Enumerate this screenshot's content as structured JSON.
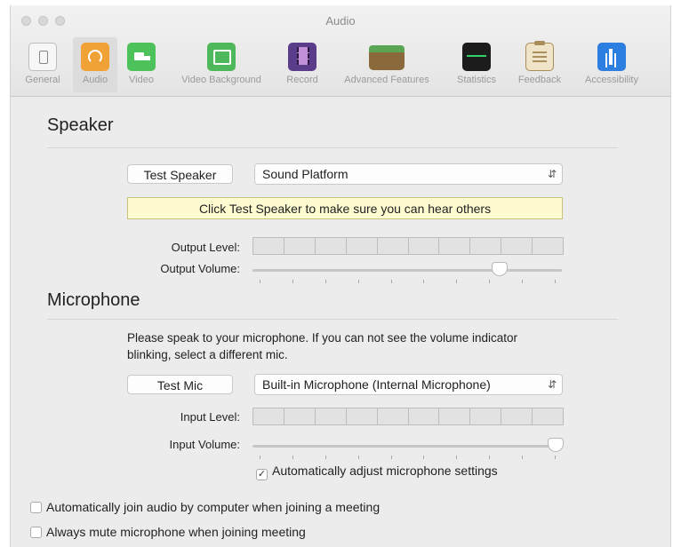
{
  "window": {
    "title": "Audio"
  },
  "toolbar": {
    "items": [
      {
        "label": "General",
        "icon": "general-icon"
      },
      {
        "label": "Audio",
        "icon": "headphones-icon",
        "selected": true
      },
      {
        "label": "Video",
        "icon": "video-camera-icon"
      },
      {
        "label": "Video Background",
        "icon": "image-icon"
      },
      {
        "label": "Record",
        "icon": "film-icon"
      },
      {
        "label": "Advanced Features",
        "icon": "wallet-icon"
      },
      {
        "label": "Statistics",
        "icon": "statistics-icon"
      },
      {
        "label": "Feedback",
        "icon": "clipboard-icon"
      },
      {
        "label": "Accessibility",
        "icon": "accessibility-icon"
      }
    ]
  },
  "speaker": {
    "title": "Speaker",
    "test_button": "Test Speaker",
    "device_select": "Sound Platform",
    "tip": "Click Test Speaker to make sure you can hear others",
    "output_level_label": "Output Level:",
    "output_volume_label": "Output Volume:",
    "output_volume_value": 0.8
  },
  "microphone": {
    "title": "Microphone",
    "instructions": "Please speak to your microphone. If you can not see the volume indicator blinking, select a different mic.",
    "test_button": "Test Mic",
    "device_select": "Built-in Microphone (Internal Microphone)",
    "input_level_label": "Input Level:",
    "input_volume_label": "Input Volume:",
    "input_volume_value": 0.98,
    "auto_adjust_label": "Automatically adjust microphone settings",
    "auto_adjust_checked": true
  },
  "options": {
    "auto_join_label": "Automatically join audio by computer when joining a meeting",
    "auto_join_checked": false,
    "always_mute_label": "Always mute microphone when joining meeting",
    "always_mute_checked": false
  }
}
